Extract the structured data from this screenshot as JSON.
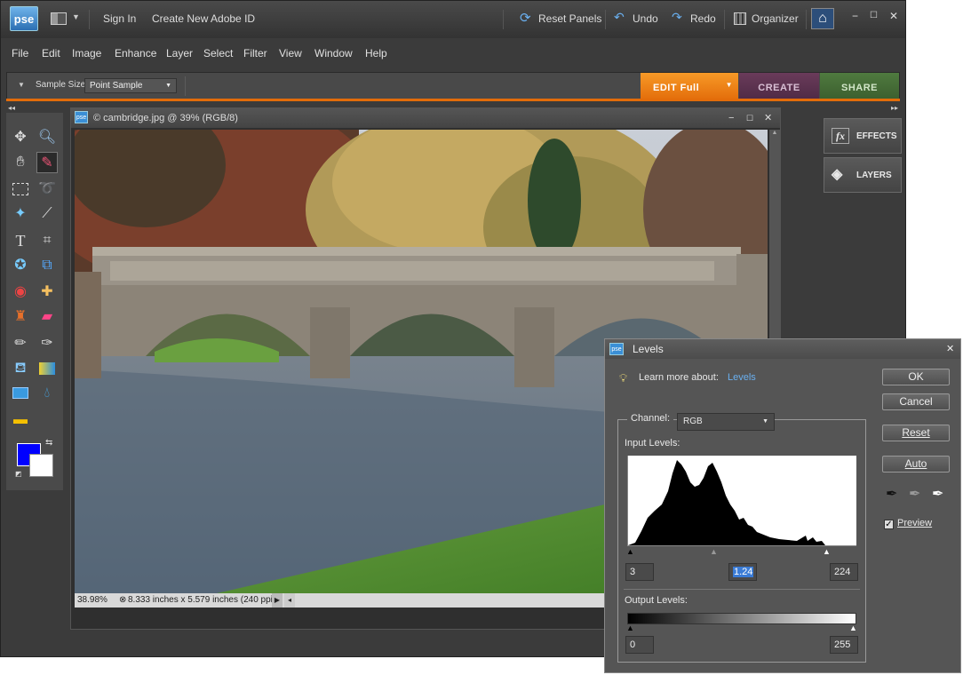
{
  "app": {
    "logo": "pse",
    "sign_in": "Sign In",
    "create_id": "Create New Adobe ID",
    "reset_panels": "Reset Panels",
    "undo": "Undo",
    "redo": "Redo",
    "organizer": "Organizer"
  },
  "menu": [
    "File",
    "Edit",
    "Image",
    "Enhance",
    "Layer",
    "Select",
    "Filter",
    "View",
    "Window",
    "Help"
  ],
  "options": {
    "sample_size_label": "Sample Size:",
    "sample_size_value": "Point Sample"
  },
  "tabs": {
    "edit": "EDIT Full",
    "create": "CREATE",
    "share": "SHARE"
  },
  "panels": {
    "effects": "EFFECTS",
    "layers": "LAYERS"
  },
  "document": {
    "title": "© cambridge.jpg @ 39% (RGB/8)",
    "zoom": "38.98%",
    "info": "8.333 inches x 5.579 inches (240 ppi)"
  },
  "colors": {
    "foreground": "#0000ff",
    "background": "#ffffff",
    "accent": "#e36c0a"
  },
  "levels": {
    "title": "Levels",
    "learn_more": "Learn more about:",
    "learn_link": "Levels",
    "channel_label": "Channel:",
    "channel_value": "RGB",
    "input_label": "Input Levels:",
    "input_black": "3",
    "input_gamma": "1.24",
    "input_white": "224",
    "output_label": "Output Levels:",
    "output_black": "0",
    "output_white": "255",
    "buttons": {
      "ok": "OK",
      "cancel": "Cancel",
      "reset": "Reset",
      "auto": "Auto"
    },
    "preview_label": "Preview",
    "preview_checked": true
  }
}
